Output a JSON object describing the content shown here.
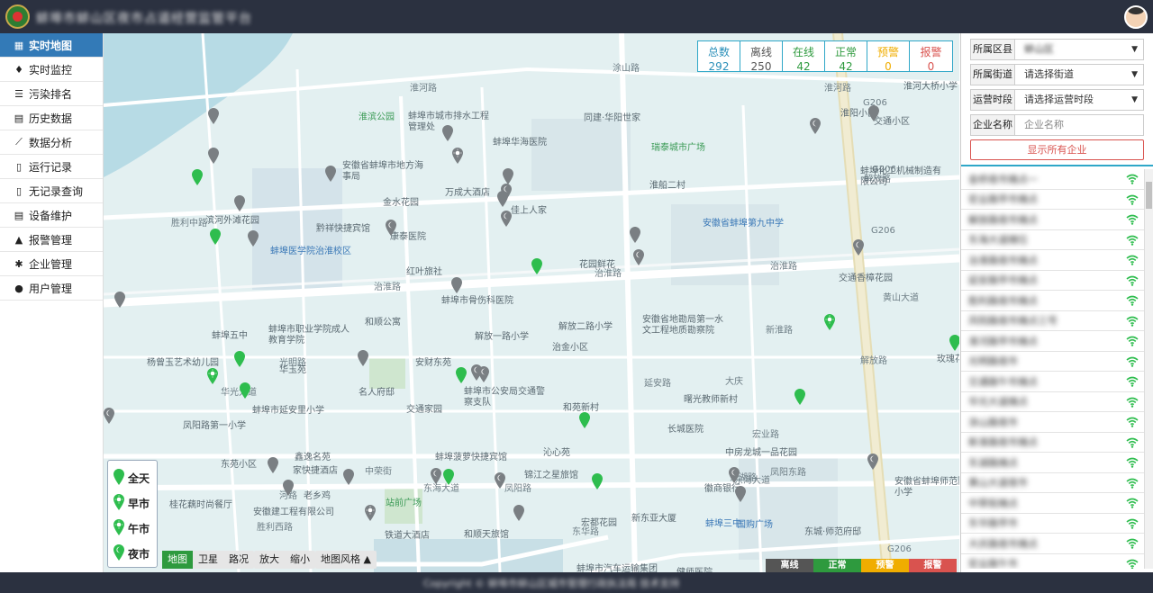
{
  "header": {
    "title": "蚌埠市蚌山区夜市占道经营监管平台",
    "logo_icon": "emblem-logo-icon",
    "avatar_icon": "user-avatar-icon"
  },
  "sidebar": {
    "items": [
      {
        "label": "实时地图",
        "icon": "map-icon",
        "glyph": "▦",
        "active": true
      },
      {
        "label": "实时监控",
        "icon": "fire-icon",
        "glyph": "♦"
      },
      {
        "label": "污染排名",
        "icon": "list-icon",
        "glyph": "☰"
      },
      {
        "label": "历史数据",
        "icon": "table-icon",
        "glyph": "▤"
      },
      {
        "label": "数据分析",
        "icon": "line-chart-icon",
        "glyph": "⟋"
      },
      {
        "label": "运行记录",
        "icon": "file-icon",
        "glyph": "▯"
      },
      {
        "label": "无记录查询",
        "icon": "file-icon",
        "glyph": "▯"
      },
      {
        "label": "设备维护",
        "icon": "file-text-icon",
        "glyph": "▤"
      },
      {
        "label": "报警管理",
        "icon": "bell-icon",
        "glyph": "▲"
      },
      {
        "label": "企业管理",
        "icon": "gear-icon",
        "glyph": "✱"
      },
      {
        "label": "用户管理",
        "icon": "user-icon",
        "glyph": "●"
      }
    ]
  },
  "stats": [
    {
      "label": "总数",
      "value": "292",
      "color": "#2a8fb9"
    },
    {
      "label": "离线",
      "value": "250",
      "color": "#555555"
    },
    {
      "label": "在线",
      "value": "42",
      "color": "#2e9a3e"
    },
    {
      "label": "正常",
      "value": "42",
      "color": "#2e9a3e"
    },
    {
      "label": "预警",
      "value": "0",
      "color": "#f0ad00"
    },
    {
      "label": "报警",
      "value": "0",
      "color": "#d9534f"
    }
  ],
  "map": {
    "roads": [
      "淮河路",
      "淮河路",
      "胜利中路",
      "治淮路",
      "治淮路",
      "治淮路",
      "光明路",
      "华光大道",
      "凤阳路",
      "河路",
      "东海大道",
      "凤阳东路",
      "东海大道",
      "胜利西路",
      "解放路",
      "解放路",
      "延安路",
      "G206",
      "G206",
      "G206",
      "G206",
      "涂山路",
      "新淮路",
      "东湖路",
      "黄山大道",
      "大庆",
      "宏业路",
      "中荣街",
      "东华路"
    ],
    "pois": [
      {
        "name": "淮滨公园",
        "style": "green"
      },
      {
        "name": "蚌埠市城市排水工程管理处",
        "style": ""
      },
      {
        "name": "蚌埠华海医院",
        "style": ""
      },
      {
        "name": "同建·华阳世家",
        "style": ""
      },
      {
        "name": "淮河大桥小学",
        "style": ""
      },
      {
        "name": "淮阳小区",
        "style": ""
      },
      {
        "name": "瑞泰城市广场",
        "style": "green"
      },
      {
        "name": "交通小区",
        "style": ""
      },
      {
        "name": "蚌埠化工机械制造有限公司",
        "style": ""
      },
      {
        "name": "安徽省蚌埠市地方海事局",
        "style": ""
      },
      {
        "name": "万成大酒店",
        "style": ""
      },
      {
        "name": "金水花园",
        "style": ""
      },
      {
        "name": "淮船二村",
        "style": ""
      },
      {
        "name": "安徽省蚌埠第九中学",
        "style": "blue"
      },
      {
        "name": "滨河外滩花园",
        "style": ""
      },
      {
        "name": "黔祥快捷宾馆",
        "style": ""
      },
      {
        "name": "康泰医院",
        "style": ""
      },
      {
        "name": "佳上人家",
        "style": ""
      },
      {
        "name": "蚌埠医学院治淮校区",
        "style": "blue"
      },
      {
        "name": "红叶旅社",
        "style": ""
      },
      {
        "name": "花园鲜花",
        "style": ""
      },
      {
        "name": "交通香樟花园",
        "style": ""
      },
      {
        "name": "蚌埠市骨伤科医院",
        "style": ""
      },
      {
        "name": "和顺公寓",
        "style": ""
      },
      {
        "name": "解放二路小学",
        "style": ""
      },
      {
        "name": "安徽省地勘局第一水文工程地质勘察院",
        "style": ""
      },
      {
        "name": "蚌埠五中",
        "style": ""
      },
      {
        "name": "蚌埠市职业学院成人教育学院",
        "style": ""
      },
      {
        "name": "解放一路小学",
        "style": ""
      },
      {
        "name": "治金小区",
        "style": ""
      },
      {
        "name": "杨曾玉艺术幼儿园",
        "style": ""
      },
      {
        "name": "华玉苑",
        "style": ""
      },
      {
        "name": "安财东苑",
        "style": ""
      },
      {
        "name": "名人府邸",
        "style": ""
      },
      {
        "name": "蚌埠市公安局交通警察支队",
        "style": ""
      },
      {
        "name": "交通家园",
        "style": ""
      },
      {
        "name": "和苑新村",
        "style": ""
      },
      {
        "name": "曙光教师新村",
        "style": ""
      },
      {
        "name": "玫瑰花园",
        "style": ""
      },
      {
        "name": "蚌埠市延安里小学",
        "style": ""
      },
      {
        "name": "凤阳路第一小学",
        "style": ""
      },
      {
        "name": "长城医院",
        "style": ""
      },
      {
        "name": "中房龙城一品花园",
        "style": ""
      },
      {
        "name": "东苑小区",
        "style": ""
      },
      {
        "name": "鑫逸名苑",
        "style": ""
      },
      {
        "name": "蚌埠菠萝快捷宾馆",
        "style": ""
      },
      {
        "name": "沁心苑",
        "style": ""
      },
      {
        "name": "家快捷酒店",
        "style": ""
      },
      {
        "name": "锦江之星旅馆",
        "style": ""
      },
      {
        "name": "徽商银行",
        "style": ""
      },
      {
        "name": "老乡鸡",
        "style": ""
      },
      {
        "name": "站前广场",
        "style": "green"
      },
      {
        "name": "安徽省蚌埠师范附属小学",
        "style": ""
      },
      {
        "name": "桂花藕时尚餐厅",
        "style": ""
      },
      {
        "name": "安徽建工程有限公司",
        "style": ""
      },
      {
        "name": "新东亚大厦",
        "style": ""
      },
      {
        "name": "宏都花园",
        "style": ""
      },
      {
        "name": "蚌埠三中",
        "style": "blue"
      },
      {
        "name": "国购广场",
        "style": "blue"
      },
      {
        "name": "东城·师范府邸",
        "style": ""
      },
      {
        "name": "和顺天旅馆",
        "style": ""
      },
      {
        "name": "铁道大酒店",
        "style": ""
      },
      {
        "name": "蚌埠市汽车运输集团有限公司",
        "style": ""
      },
      {
        "name": "健师医院",
        "style": ""
      }
    ]
  },
  "legend": [
    {
      "label": "全天",
      "icon": "pin-allday-icon"
    },
    {
      "label": "早市",
      "icon": "pin-morning-icon"
    },
    {
      "label": "午市",
      "icon": "pin-noon-icon"
    },
    {
      "label": "夜市",
      "icon": "pin-night-icon"
    }
  ],
  "map_controls": {
    "type_buttons": [
      "地图",
      "卫星",
      "路况"
    ],
    "zoom_buttons": [
      "放大",
      "缩小"
    ],
    "style_button": "地图风格 ▲"
  },
  "status_legend": [
    {
      "label": "离线",
      "color": "#555555"
    },
    {
      "label": "正常",
      "color": "#2e9a3e"
    },
    {
      "label": "预警",
      "color": "#f0ad00"
    },
    {
      "label": "报警",
      "color": "#d9534f"
    }
  ],
  "filters": {
    "district_label": "所属区县",
    "district_value": "蚌山区",
    "street_label": "所属街道",
    "street_placeholder": "请选择街道",
    "period_label": "运营时段",
    "period_placeholder": "请选择运营时段",
    "name_label": "企业名称",
    "name_placeholder": "企业名称",
    "show_all_button": "显示所有企业"
  },
  "enterprises": [
    "金桥夜市摊点一",
    "宏业路早市摊点",
    "解放路夜市摊点",
    "东海大道摊位",
    "治淮路夜市摊点",
    "延安路早市摊点",
    "胜利路夜市摊点",
    "凤阳路夜市摊点三号",
    "淮河路早市摊点",
    "光明路夜市",
    "交通路午市摊点",
    "华光大道摊点",
    "涂山路夜市",
    "新淮路夜市摊点",
    "东湖路摊点",
    "黄山大道夜市",
    "中荣街摊点",
    "东华路早市",
    "大庆路夜市摊点",
    "宏业路午市",
    "解放路早市摊点",
    "纬四路夜市"
  ],
  "footer": {
    "text": "Copyright © 蚌埠市蚌山区城市管理行政执法局 技术支持"
  }
}
